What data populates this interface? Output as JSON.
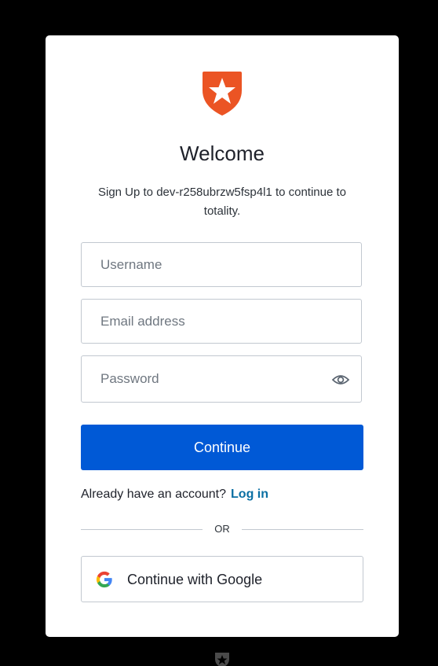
{
  "card": {
    "logo_icon": "auth0-shield-star-icon",
    "title": "Welcome",
    "subtitle": "Sign Up to dev-r258ubrzw5fsp4l1 to continue to totality."
  },
  "form": {
    "username_placeholder": "Username",
    "email_placeholder": "Email address",
    "password_placeholder": "Password",
    "password_toggle_icon": "eye-icon",
    "continue_label": "Continue"
  },
  "login": {
    "prompt": "Already have an account?",
    "link_label": "Log in"
  },
  "divider": {
    "label": "OR"
  },
  "social": {
    "google_label": "Continue with Google",
    "google_icon": "google-icon"
  },
  "footer": {
    "logo_icon": "auth0-badge-icon"
  },
  "colors": {
    "brand": "#eb5424",
    "primary_button": "#0059d6",
    "link": "#0a6fa3",
    "border": "#c2c8d0",
    "background": "#000000"
  }
}
